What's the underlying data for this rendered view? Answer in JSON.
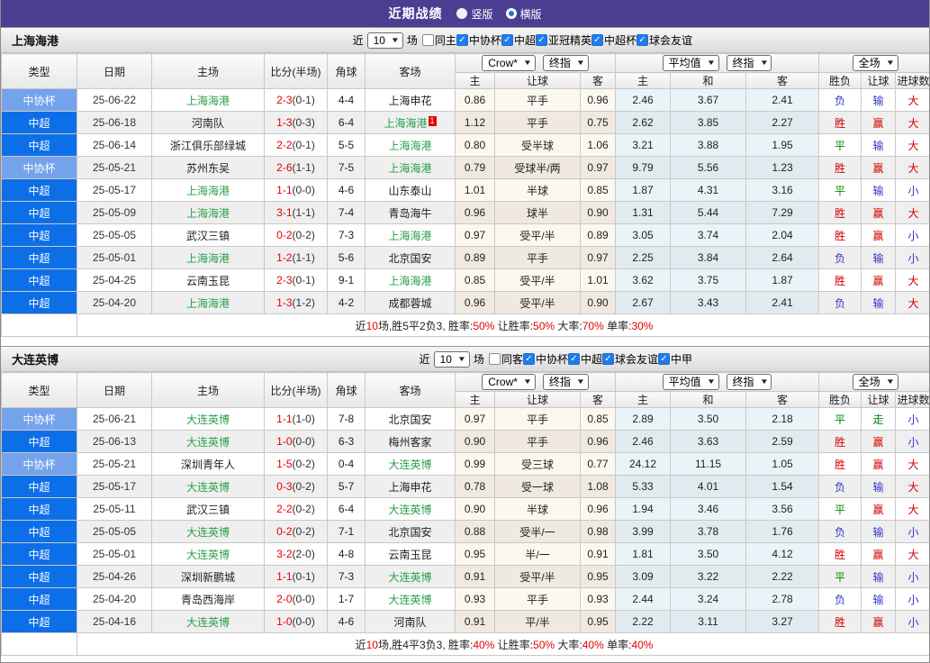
{
  "header": {
    "title": "近期战绩",
    "layout_options": [
      {
        "label": "竖版",
        "selected": false
      },
      {
        "label": "横版",
        "selected": true
      }
    ]
  },
  "table": {
    "filter_prefix": "近",
    "filter_suffix": "场",
    "col_headers": {
      "type": "类型",
      "date": "日期",
      "home": "主场",
      "score": "比分(半场)",
      "corner": "角球",
      "away": "客场",
      "odds_sub": [
        "主",
        "让球",
        "客"
      ],
      "avg_sub": [
        "主",
        "和",
        "客"
      ],
      "result_sub": [
        "胜负",
        "让球",
        "进球数"
      ],
      "selects": {
        "crow": "Crow*",
        "crow_final": "终指",
        "avg": "平均值",
        "avg_final": "终指",
        "full": "全场"
      }
    }
  },
  "colors": {
    "topbar_bg": "#4b3e92",
    "league_super_bg": "#0d6fe8",
    "league_cup_bg": "#74a3ec",
    "active_team": "#2aa04a",
    "score_red": "#e60000",
    "outcome_red": "#d40000",
    "outcome_blue": "#3333cc",
    "outcome_green": "#008800",
    "radio_selected": "#2a6fd6",
    "checkbox_checked": "#1f7ce8"
  },
  "sections": [
    {
      "team": "上海海港",
      "filter": {
        "count": "10",
        "same": {
          "label": "同主",
          "checked": false
        },
        "leagues": [
          {
            "label": "中协杯",
            "checked": true
          },
          {
            "label": "中超",
            "checked": true
          },
          {
            "label": "亚冠精英",
            "checked": true
          },
          {
            "label": "中超杯",
            "checked": true
          },
          {
            "label": "球会友谊",
            "checked": true
          }
        ]
      },
      "rows": [
        {
          "league": "中协杯",
          "league_style": "cup",
          "date": "25-06-22",
          "home": "上海海港",
          "home_active": true,
          "score": "2-3",
          "half": "(0-1)",
          "corners": "4-4",
          "away": "上海申花",
          "away_active": false,
          "odds": [
            "0.86",
            "平手",
            "0.96"
          ],
          "avg": [
            "2.46",
            "3.67",
            "2.41"
          ],
          "outcome": [
            {
              "t": "负",
              "c": "blue"
            },
            {
              "t": "输",
              "c": "blue"
            },
            {
              "t": "大",
              "c": "red"
            }
          ]
        },
        {
          "league": "中超",
          "league_style": "super",
          "date": "25-06-18",
          "home": "河南队",
          "home_active": false,
          "score": "1-3",
          "half": "(0-3)",
          "corners": "6-4",
          "away": "上海海港",
          "away_active": true,
          "away_badge": "1",
          "odds": [
            "1.12",
            "平手",
            "0.75"
          ],
          "avg": [
            "2.62",
            "3.85",
            "2.27"
          ],
          "outcome": [
            {
              "t": "胜",
              "c": "red"
            },
            {
              "t": "赢",
              "c": "red"
            },
            {
              "t": "大",
              "c": "red"
            }
          ]
        },
        {
          "league": "中超",
          "league_style": "super",
          "date": "25-06-14",
          "home": "浙江俱乐部绿城",
          "home_active": false,
          "score": "2-2",
          "half": "(0-1)",
          "corners": "5-5",
          "away": "上海海港",
          "away_active": true,
          "odds": [
            "0.80",
            "受半球",
            "1.06"
          ],
          "avg": [
            "3.21",
            "3.88",
            "1.95"
          ],
          "outcome": [
            {
              "t": "平",
              "c": "green"
            },
            {
              "t": "输",
              "c": "blue"
            },
            {
              "t": "大",
              "c": "red"
            }
          ]
        },
        {
          "league": "中协杯",
          "league_style": "cup",
          "date": "25-05-21",
          "home": "苏州东吴",
          "home_active": false,
          "score": "2-6",
          "half": "(1-1)",
          "corners": "7-5",
          "away": "上海海港",
          "away_active": true,
          "odds": [
            "0.79",
            "受球半/两",
            "0.97"
          ],
          "avg": [
            "9.79",
            "5.56",
            "1.23"
          ],
          "outcome": [
            {
              "t": "胜",
              "c": "red"
            },
            {
              "t": "赢",
              "c": "red"
            },
            {
              "t": "大",
              "c": "red"
            }
          ]
        },
        {
          "league": "中超",
          "league_style": "super",
          "date": "25-05-17",
          "home": "上海海港",
          "home_active": true,
          "score": "1-1",
          "half": "(0-0)",
          "corners": "4-6",
          "away": "山东泰山",
          "away_active": false,
          "odds": [
            "1.01",
            "半球",
            "0.85"
          ],
          "avg": [
            "1.87",
            "4.31",
            "3.16"
          ],
          "outcome": [
            {
              "t": "平",
              "c": "green"
            },
            {
              "t": "输",
              "c": "blue"
            },
            {
              "t": "小",
              "c": "blue"
            }
          ]
        },
        {
          "league": "中超",
          "league_style": "super",
          "date": "25-05-09",
          "home": "上海海港",
          "home_active": true,
          "score": "3-1",
          "half": "(1-1)",
          "corners": "7-4",
          "away": "青岛海牛",
          "away_active": false,
          "odds": [
            "0.96",
            "球半",
            "0.90"
          ],
          "avg": [
            "1.31",
            "5.44",
            "7.29"
          ],
          "outcome": [
            {
              "t": "胜",
              "c": "red"
            },
            {
              "t": "赢",
              "c": "red"
            },
            {
              "t": "大",
              "c": "red"
            }
          ]
        },
        {
          "league": "中超",
          "league_style": "super",
          "date": "25-05-05",
          "home": "武汉三镇",
          "home_active": false,
          "score": "0-2",
          "half": "(0-2)",
          "corners": "7-3",
          "away": "上海海港",
          "away_active": true,
          "odds": [
            "0.97",
            "受平/半",
            "0.89"
          ],
          "avg": [
            "3.05",
            "3.74",
            "2.04"
          ],
          "outcome": [
            {
              "t": "胜",
              "c": "red"
            },
            {
              "t": "赢",
              "c": "red"
            },
            {
              "t": "小",
              "c": "blue"
            }
          ]
        },
        {
          "league": "中超",
          "league_style": "super",
          "date": "25-05-01",
          "home": "上海海港",
          "home_active": true,
          "score": "1-2",
          "half": "(1-1)",
          "corners": "5-6",
          "away": "北京国安",
          "away_active": false,
          "odds": [
            "0.89",
            "平手",
            "0.97"
          ],
          "avg": [
            "2.25",
            "3.84",
            "2.64"
          ],
          "outcome": [
            {
              "t": "负",
              "c": "blue"
            },
            {
              "t": "输",
              "c": "blue"
            },
            {
              "t": "小",
              "c": "blue"
            }
          ]
        },
        {
          "league": "中超",
          "league_style": "super",
          "date": "25-04-25",
          "home": "云南玉昆",
          "home_active": false,
          "score": "2-3",
          "half": "(0-1)",
          "corners": "9-1",
          "away": "上海海港",
          "away_active": true,
          "odds": [
            "0.85",
            "受平/半",
            "1.01"
          ],
          "avg": [
            "3.62",
            "3.75",
            "1.87"
          ],
          "outcome": [
            {
              "t": "胜",
              "c": "red"
            },
            {
              "t": "赢",
              "c": "red"
            },
            {
              "t": "大",
              "c": "red"
            }
          ]
        },
        {
          "league": "中超",
          "league_style": "super",
          "date": "25-04-20",
          "home": "上海海港",
          "home_active": true,
          "score": "1-3",
          "half": "(1-2)",
          "corners": "4-2",
          "away": "成都蓉城",
          "away_active": false,
          "odds": [
            "0.96",
            "受平/半",
            "0.90"
          ],
          "avg": [
            "2.67",
            "3.43",
            "2.41"
          ],
          "outcome": [
            {
              "t": "负",
              "c": "blue"
            },
            {
              "t": "输",
              "c": "blue"
            },
            {
              "t": "大",
              "c": "red"
            }
          ]
        }
      ],
      "summary": [
        {
          "t": "近",
          "red": false
        },
        {
          "t": "10",
          "red": true
        },
        {
          "t": "场,胜5平2负3, 胜率:",
          "red": false
        },
        {
          "t": "50%",
          "red": true
        },
        {
          "t": " 让胜率:",
          "red": false
        },
        {
          "t": "50%",
          "red": true
        },
        {
          "t": " 大率:",
          "red": false
        },
        {
          "t": "70%",
          "red": true
        },
        {
          "t": " 单率:",
          "red": false
        },
        {
          "t": "30%",
          "red": true
        }
      ]
    },
    {
      "team": "大连英博",
      "filter": {
        "count": "10",
        "same": {
          "label": "同客",
          "checked": false
        },
        "leagues": [
          {
            "label": "中协杯",
            "checked": true
          },
          {
            "label": "中超",
            "checked": true
          },
          {
            "label": "球会友谊",
            "checked": true
          },
          {
            "label": "中甲",
            "checked": true
          }
        ]
      },
      "rows": [
        {
          "league": "中协杯",
          "league_style": "cup",
          "date": "25-06-21",
          "home": "大连英博",
          "home_active": true,
          "score": "1-1",
          "half": "(1-0)",
          "corners": "7-8",
          "away": "北京国安",
          "away_active": false,
          "odds": [
            "0.97",
            "平手",
            "0.85"
          ],
          "avg": [
            "2.89",
            "3.50",
            "2.18"
          ],
          "outcome": [
            {
              "t": "平",
              "c": "green"
            },
            {
              "t": "走",
              "c": "green"
            },
            {
              "t": "小",
              "c": "blue"
            }
          ]
        },
        {
          "league": "中超",
          "league_style": "super",
          "date": "25-06-13",
          "home": "大连英博",
          "home_active": true,
          "score": "1-0",
          "half": "(0-0)",
          "corners": "6-3",
          "away": "梅州客家",
          "away_active": false,
          "odds": [
            "0.90",
            "平手",
            "0.96"
          ],
          "avg": [
            "2.46",
            "3.63",
            "2.59"
          ],
          "outcome": [
            {
              "t": "胜",
              "c": "red"
            },
            {
              "t": "赢",
              "c": "red"
            },
            {
              "t": "小",
              "c": "blue"
            }
          ]
        },
        {
          "league": "中协杯",
          "league_style": "cup",
          "date": "25-05-21",
          "home": "深圳青年人",
          "home_active": false,
          "score": "1-5",
          "half": "(0-2)",
          "corners": "0-4",
          "away": "大连英博",
          "away_active": true,
          "odds": [
            "0.99",
            "受三球",
            "0.77"
          ],
          "avg": [
            "24.12",
            "11.15",
            "1.05"
          ],
          "outcome": [
            {
              "t": "胜",
              "c": "red"
            },
            {
              "t": "赢",
              "c": "red"
            },
            {
              "t": "大",
              "c": "red"
            }
          ]
        },
        {
          "league": "中超",
          "league_style": "super",
          "date": "25-05-17",
          "home": "大连英博",
          "home_active": true,
          "score": "0-3",
          "half": "(0-2)",
          "corners": "5-7",
          "away": "上海申花",
          "away_active": false,
          "odds": [
            "0.78",
            "受一球",
            "1.08"
          ],
          "avg": [
            "5.33",
            "4.01",
            "1.54"
          ],
          "outcome": [
            {
              "t": "负",
              "c": "blue"
            },
            {
              "t": "输",
              "c": "blue"
            },
            {
              "t": "大",
              "c": "red"
            }
          ]
        },
        {
          "league": "中超",
          "league_style": "super",
          "date": "25-05-11",
          "home": "武汉三镇",
          "home_active": false,
          "score": "2-2",
          "half": "(0-2)",
          "corners": "6-4",
          "away": "大连英博",
          "away_active": true,
          "odds": [
            "0.90",
            "半球",
            "0.96"
          ],
          "avg": [
            "1.94",
            "3.46",
            "3.56"
          ],
          "outcome": [
            {
              "t": "平",
              "c": "green"
            },
            {
              "t": "赢",
              "c": "red"
            },
            {
              "t": "大",
              "c": "red"
            }
          ]
        },
        {
          "league": "中超",
          "league_style": "super",
          "date": "25-05-05",
          "home": "大连英博",
          "home_active": true,
          "score": "0-2",
          "half": "(0-2)",
          "corners": "7-1",
          "away": "北京国安",
          "away_active": false,
          "odds": [
            "0.88",
            "受半/一",
            "0.98"
          ],
          "avg": [
            "3.99",
            "3.78",
            "1.76"
          ],
          "outcome": [
            {
              "t": "负",
              "c": "blue"
            },
            {
              "t": "输",
              "c": "blue"
            },
            {
              "t": "小",
              "c": "blue"
            }
          ]
        },
        {
          "league": "中超",
          "league_style": "super",
          "date": "25-05-01",
          "home": "大连英博",
          "home_active": true,
          "score": "3-2",
          "half": "(2-0)",
          "corners": "4-8",
          "away": "云南玉昆",
          "away_active": false,
          "odds": [
            "0.95",
            "半/一",
            "0.91"
          ],
          "avg": [
            "1.81",
            "3.50",
            "4.12"
          ],
          "outcome": [
            {
              "t": "胜",
              "c": "red"
            },
            {
              "t": "赢",
              "c": "red"
            },
            {
              "t": "大",
              "c": "red"
            }
          ]
        },
        {
          "league": "中超",
          "league_style": "super",
          "date": "25-04-26",
          "home": "深圳新鹏城",
          "home_active": false,
          "score": "1-1",
          "half": "(0-1)",
          "corners": "7-3",
          "away": "大连英博",
          "away_active": true,
          "odds": [
            "0.91",
            "受平/半",
            "0.95"
          ],
          "avg": [
            "3.09",
            "3.22",
            "2.22"
          ],
          "outcome": [
            {
              "t": "平",
              "c": "green"
            },
            {
              "t": "输",
              "c": "blue"
            },
            {
              "t": "小",
              "c": "blue"
            }
          ]
        },
        {
          "league": "中超",
          "league_style": "super",
          "date": "25-04-20",
          "home": "青岛西海岸",
          "home_active": false,
          "score": "2-0",
          "half": "(0-0)",
          "corners": "1-7",
          "away": "大连英博",
          "away_active": true,
          "odds": [
            "0.93",
            "平手",
            "0.93"
          ],
          "avg": [
            "2.44",
            "3.24",
            "2.78"
          ],
          "outcome": [
            {
              "t": "负",
              "c": "blue"
            },
            {
              "t": "输",
              "c": "blue"
            },
            {
              "t": "小",
              "c": "blue"
            }
          ]
        },
        {
          "league": "中超",
          "league_style": "super",
          "date": "25-04-16",
          "home": "大连英博",
          "home_active": true,
          "score": "1-0",
          "half": "(0-0)",
          "corners": "4-6",
          "away": "河南队",
          "away_active": false,
          "odds": [
            "0.91",
            "平/半",
            "0.95"
          ],
          "avg": [
            "2.22",
            "3.11",
            "3.27"
          ],
          "outcome": [
            {
              "t": "胜",
              "c": "red"
            },
            {
              "t": "赢",
              "c": "red"
            },
            {
              "t": "小",
              "c": "blue"
            }
          ]
        }
      ],
      "summary": [
        {
          "t": "近",
          "red": false
        },
        {
          "t": "10",
          "red": true
        },
        {
          "t": "场,胜4平3负3, 胜率:",
          "red": false
        },
        {
          "t": "40%",
          "red": true
        },
        {
          "t": " 让胜率:",
          "red": false
        },
        {
          "t": "50%",
          "red": true
        },
        {
          "t": " 大率:",
          "red": false
        },
        {
          "t": "40%",
          "red": true
        },
        {
          "t": " 单率:",
          "red": false
        },
        {
          "t": "40%",
          "red": true
        }
      ]
    }
  ]
}
